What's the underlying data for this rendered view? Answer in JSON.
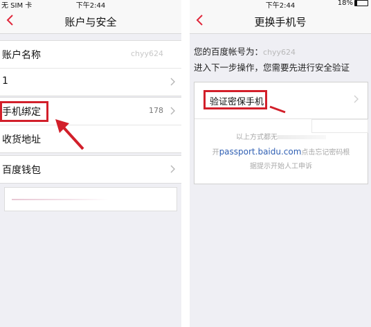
{
  "status_bar": {
    "sim": "无 SIM 卡",
    "time": "下午2:44",
    "battery": "18%"
  },
  "left": {
    "nav": {
      "title": "账户与安全"
    },
    "rows": [
      {
        "label": "账户名称",
        "value": "chyy624"
      },
      {
        "label": "1",
        "value": ""
      },
      {
        "label": "手机绑定",
        "value": "178"
      },
      {
        "label": "收货地址",
        "value": ""
      },
      {
        "label": "百度钱包",
        "value": ""
      }
    ]
  },
  "right": {
    "nav": {
      "title": "更换手机号"
    },
    "account_prefix": "您的百度帐号为：",
    "account_value": "chyy624",
    "instruction": "进入下一步操作，您需要先进行安全验证",
    "verify_label": "验证密保手机",
    "hint_line1": "以上方式都无",
    "hint_link": "passport.baidu.com",
    "hint_line2_suffix": "点击忘记密码根",
    "hint_line3": "据提示开始人工申诉"
  },
  "colors": {
    "accent": "#e0263a",
    "highlight": "#d21f2a",
    "link": "#2f5fb3"
  }
}
